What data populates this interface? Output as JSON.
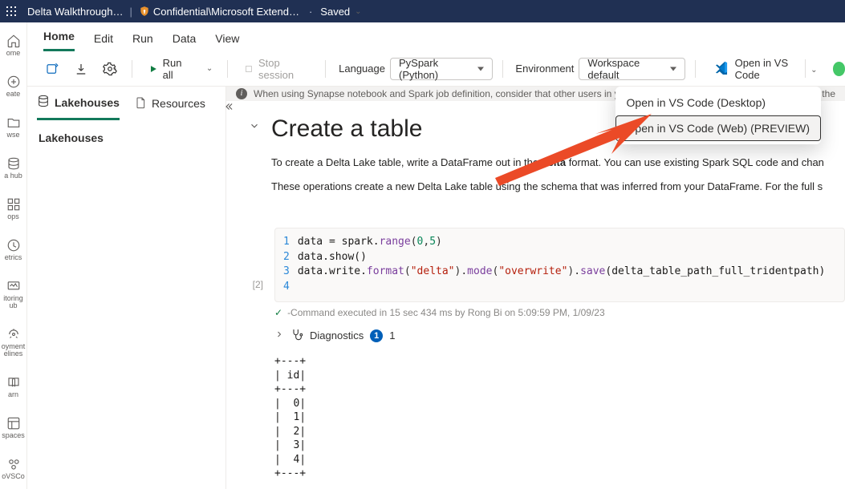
{
  "header": {
    "doc_title": "Delta Walkthrough…",
    "sensitivity": "Confidential\\Microsoft Extend…",
    "saved_status": "Saved"
  },
  "left_rail": {
    "items": [
      {
        "label": "ome"
      },
      {
        "label": "eate"
      },
      {
        "label": "wse"
      },
      {
        "label": "a hub"
      },
      {
        "label": "ops"
      },
      {
        "label": "etrics"
      },
      {
        "label": "itoring\nub"
      },
      {
        "label": "oyment\nelines"
      },
      {
        "label": "arn"
      },
      {
        "label": "spaces"
      },
      {
        "label": "oVSCo"
      }
    ]
  },
  "menu_tabs": {
    "items": [
      "Home",
      "Edit",
      "Run",
      "Data",
      "View"
    ],
    "active": 0
  },
  "toolbar": {
    "run_all": "Run all",
    "stop_session": "Stop session",
    "language_label": "Language",
    "language_value": "PySpark (Python)",
    "environment_label": "Environment",
    "environment_value": "Workspace default",
    "open_vscode": "Open in VS Code"
  },
  "vscode_dropdown": {
    "items": [
      "Open in VS Code (Desktop)",
      "Open in VS Code (Web) (PREVIEW)"
    ]
  },
  "side_panel": {
    "tabs": [
      "Lakehouses",
      "Resources"
    ],
    "active": 0,
    "body_heading": "Lakehouses"
  },
  "info_bar": {
    "text": "When using Synapse notebook and Spark job definition, consider that other users in your organization"
  },
  "notebook": {
    "markdown": {
      "title": "Create a table",
      "paragraph1_prefix": "To create a Delta Lake table, write a DataFrame out in the ",
      "paragraph1_bold": "delta",
      "paragraph1_suffix": " format. You can use existing Spark SQL code and chan",
      "paragraph2": "These operations create a new Delta Lake table using the schema that was inferred from your DataFrame. For the full s"
    },
    "code": {
      "exec_label": "[2]",
      "line1_a": "data = spark.",
      "line1_b": "range",
      "line1_c": "(",
      "line1_d": "0",
      "line1_e": ",",
      "line1_f": "5",
      "line1_g": ")",
      "line2": "data.show()",
      "line3_a": "data.write.",
      "line3_b": "format",
      "line3_c": "(",
      "line3_d": "\"delta\"",
      "line3_e": ").",
      "line3_f": "mode",
      "line3_g": "(",
      "line3_h": "\"overwrite\"",
      "line3_i": ").",
      "line3_j": "save",
      "line3_k": "(delta_table_path_full_tridentpath)"
    },
    "exec_status": "-Command executed in 15 sec 434 ms by Rong Bi on 5:09:59 PM, 1/09/23",
    "diagnostics_label": "Diagnostics",
    "diagnostics_count": "1",
    "output_lines": "+---+\n| id|\n+---+\n|  0|\n|  1|\n|  2|\n|  3|\n|  4|\n+---+"
  },
  "trail_text": "use the"
}
